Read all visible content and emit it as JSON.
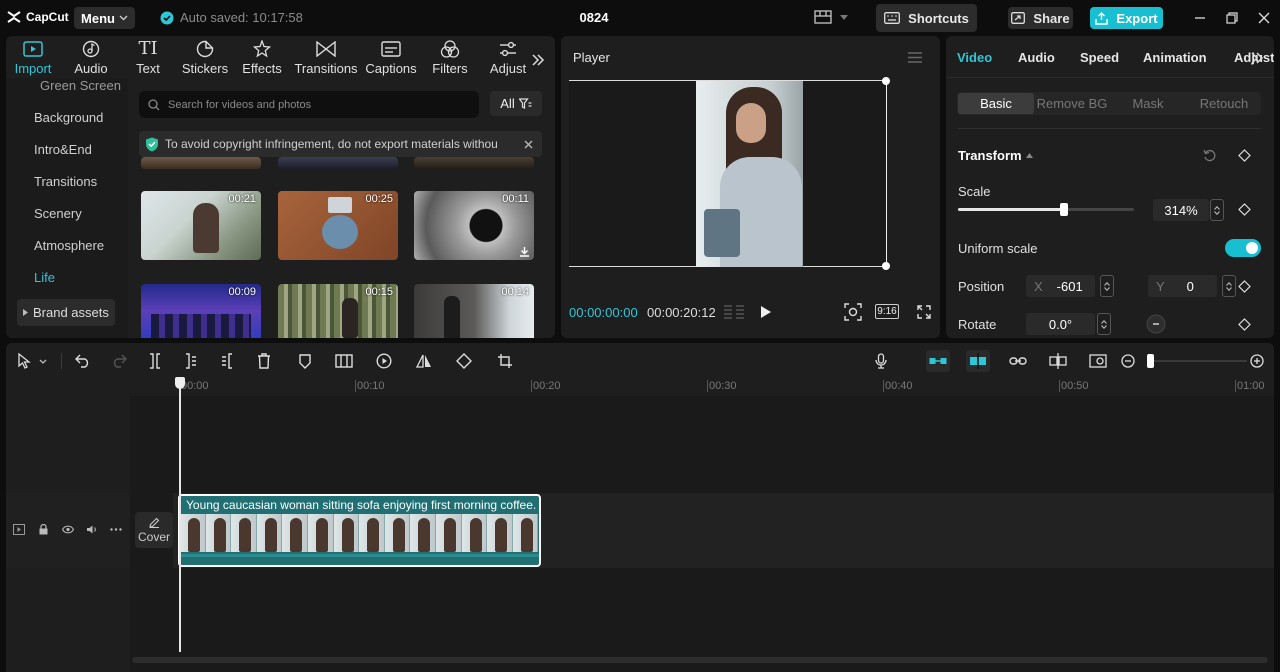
{
  "app": {
    "logo": "CapCut",
    "menu_label": "Menu",
    "autosave": "Auto saved: 10:17:58",
    "project_title": "0824"
  },
  "top_actions": {
    "shortcuts": "Shortcuts",
    "share": "Share",
    "export": "Export"
  },
  "media_tools": [
    {
      "label": "Import",
      "icon": "import-icon",
      "active": true
    },
    {
      "label": "Audio",
      "icon": "audio-icon"
    },
    {
      "label": "Text",
      "icon": "text-icon"
    },
    {
      "label": "Stickers",
      "icon": "stickers-icon"
    },
    {
      "label": "Effects",
      "icon": "effects-icon"
    },
    {
      "label": "Transitions",
      "icon": "transitions-icon"
    },
    {
      "label": "Captions",
      "icon": "captions-icon"
    },
    {
      "label": "Filters",
      "icon": "filters-icon"
    },
    {
      "label": "Adjust",
      "icon": "adjust-icon"
    }
  ],
  "categories": [
    "Green Screen",
    "Background",
    "Intro&End",
    "Transitions",
    "Scenery",
    "Atmosphere",
    "Life"
  ],
  "active_category": "Life",
  "brand_assets": "Brand assets",
  "search": {
    "placeholder": "Search for videos and photos",
    "filter_label": "All"
  },
  "copyright_notice": "To avoid copyright infringement, do not export materials withou",
  "thumbnails": [
    {
      "duration": "00:21"
    },
    {
      "duration": "00:25"
    },
    {
      "duration": "00:11"
    },
    {
      "duration": "00:09"
    },
    {
      "duration": "00:15"
    },
    {
      "duration": "00:14"
    }
  ],
  "player": {
    "title": "Player",
    "current_time": "00:00:00:00",
    "total_time": "00:00:20:12",
    "ratio": "9:16"
  },
  "properties": {
    "tabs": [
      "Video",
      "Audio",
      "Speed",
      "Animation",
      "Adjust"
    ],
    "active_tab": "Video",
    "subtabs": [
      "Basic",
      "Remove BG",
      "Mask",
      "Retouch"
    ],
    "section": "Transform",
    "scale_label": "Scale",
    "scale_value": "314%",
    "scale_slider_level": 0.6,
    "uniform_scale_label": "Uniform scale",
    "uniform_scale_on": true,
    "position_label": "Position",
    "pos_x_axis": "X",
    "pos_x": "-601",
    "pos_y_axis": "Y",
    "pos_y": "0",
    "rotate_label": "Rotate",
    "rotate_value": "0.0°"
  },
  "ruler": [
    "00:00",
    "00:10",
    "00:20",
    "00:30",
    "00:40",
    "00:50",
    "01:00"
  ],
  "track": {
    "cover_label": "Cover",
    "clip_title": "Young caucasian woman sitting sofa enjoying first morning coffee."
  },
  "colors": {
    "accent": "#2ec7d8",
    "export": "#18bfd0",
    "clip": "#1f6f73",
    "panel": "#1e1e1e"
  }
}
